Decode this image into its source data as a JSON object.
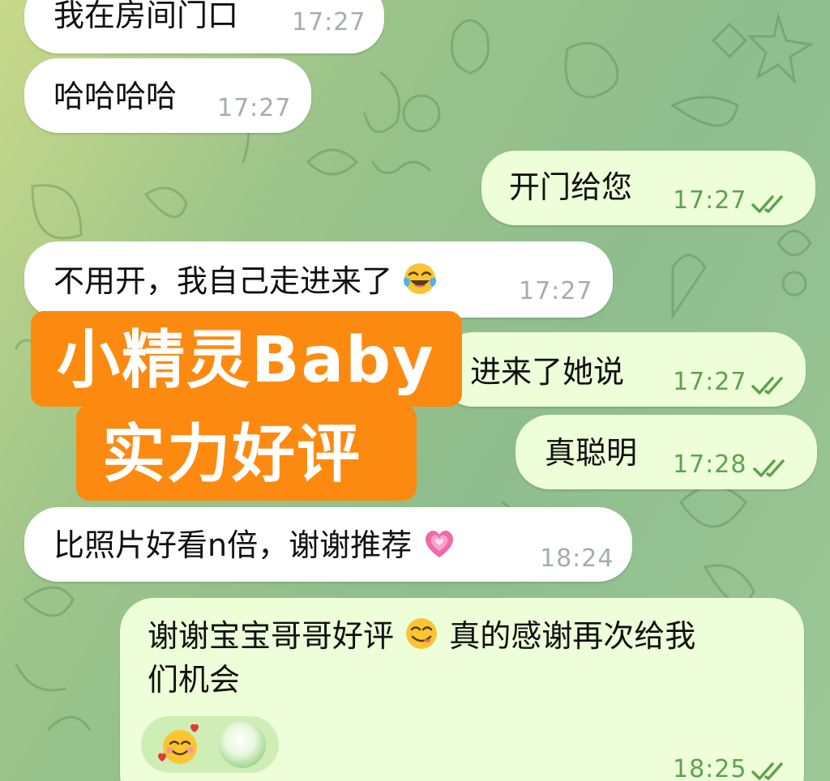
{
  "messages": [
    {
      "id": "m1",
      "side": "incoming",
      "text": "我在房间门口",
      "time": "17:27"
    },
    {
      "id": "m2",
      "side": "incoming",
      "text": "哈哈哈哈",
      "time": "17:27"
    },
    {
      "id": "m3",
      "side": "outgoing",
      "text": "开门给您",
      "time": "17:27",
      "read": true
    },
    {
      "id": "m4",
      "side": "incoming",
      "text": "不用开，我自己走进来了",
      "emoji": "face-with-tears-of-joy",
      "time": "17:27"
    },
    {
      "id": "m5",
      "side": "outgoing",
      "text": "进来了她说",
      "time": "17:27",
      "read": true
    },
    {
      "id": "m6",
      "side": "outgoing",
      "text": "真聪明",
      "time": "17:28",
      "read": true
    },
    {
      "id": "m7",
      "side": "incoming",
      "text": "比照片好看n倍，谢谢推荐",
      "emoji": "growing-heart",
      "time": "18:24"
    },
    {
      "id": "m8",
      "side": "outgoing",
      "text_line1": "谢谢宝宝哥哥好评",
      "emoji": "face-savoring-food",
      "text_line1b": "真的感谢再次给我",
      "text_line2": "们机会",
      "time": "18:25",
      "read": true,
      "reaction_emoji": "smiling-face-with-hearts"
    }
  ],
  "promo": {
    "line1": "小精灵Baby",
    "line2": "实力好评",
    "color": "#fd8a10"
  },
  "colors": {
    "incoming_bubble": "#ffffff",
    "outgoing_bubble": "#eefed8",
    "outgoing_time": "#5ea24f",
    "incoming_time": "#a7acb1"
  }
}
